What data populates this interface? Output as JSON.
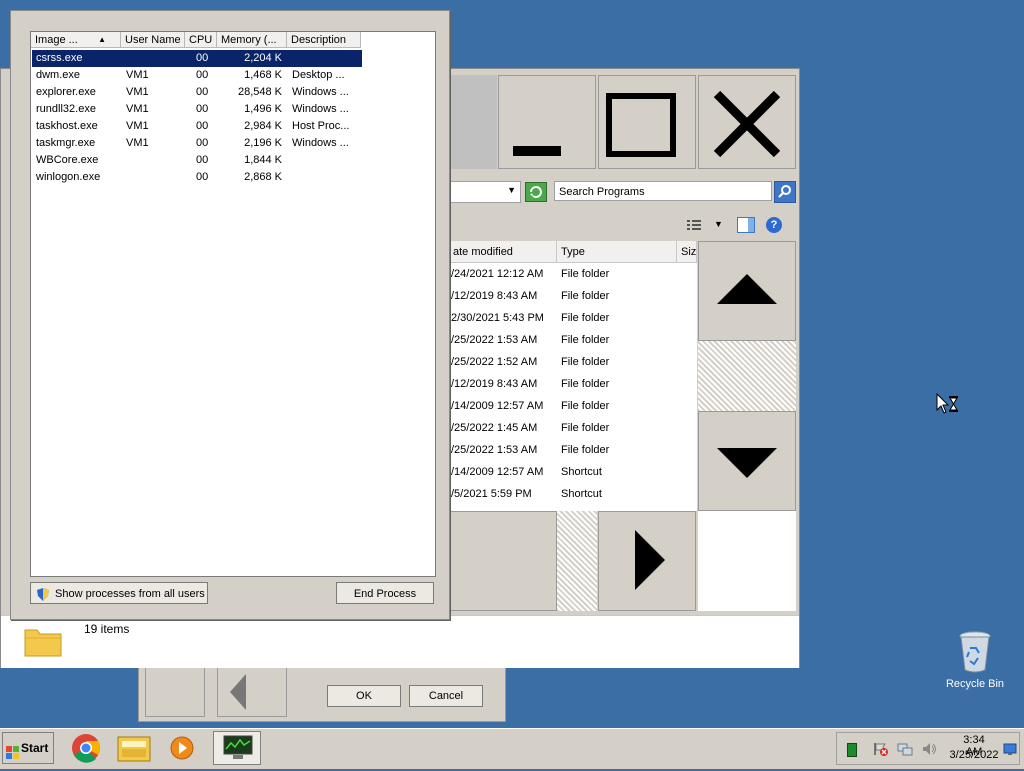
{
  "desktop": {
    "recycle_bin_label": "Recycle Bin"
  },
  "explorer": {
    "search_placeholder": "Search Programs",
    "columns": {
      "date_modified": "ate modified",
      "type": "Type",
      "size": "Size"
    },
    "files": [
      {
        "date": "/24/2021 12:12 AM",
        "type": "File folder"
      },
      {
        "date": "/12/2019 8:43 AM",
        "type": "File folder"
      },
      {
        "date": "2/30/2021 5:43 PM",
        "type": "File folder"
      },
      {
        "date": "/25/2022 1:53 AM",
        "type": "File folder"
      },
      {
        "date": "/25/2022 1:52 AM",
        "type": "File folder"
      },
      {
        "date": "/12/2019 8:43 AM",
        "type": "File folder"
      },
      {
        "date": "/14/2009 12:57 AM",
        "type": "File folder"
      },
      {
        "date": "/25/2022 1:45 AM",
        "type": "File folder"
      },
      {
        "date": "/25/2022 1:53 AM",
        "type": "File folder"
      },
      {
        "date": "/14/2009 12:57 AM",
        "type": "Shortcut"
      },
      {
        "date": "/5/2021 5:59 PM",
        "type": "Shortcut"
      }
    ],
    "status": "19 items"
  },
  "back_dialog": {
    "ok_label": "OK",
    "cancel_label": "Cancel"
  },
  "taskmgr": {
    "columns": {
      "image": "Image ...",
      "user": "User Name",
      "cpu": "CPU",
      "memory": "Memory (...",
      "description": "Description"
    },
    "processes": [
      {
        "image": "csrss.exe",
        "user": "",
        "cpu": "00",
        "memory": "2,204 K",
        "description": ""
      },
      {
        "image": "dwm.exe",
        "user": "VM1",
        "cpu": "00",
        "memory": "1,468 K",
        "description": "Desktop ..."
      },
      {
        "image": "explorer.exe",
        "user": "VM1",
        "cpu": "00",
        "memory": "28,548 K",
        "description": "Windows ..."
      },
      {
        "image": "rundll32.exe",
        "user": "VM1",
        "cpu": "00",
        "memory": "1,496 K",
        "description": "Windows ..."
      },
      {
        "image": "taskhost.exe",
        "user": "VM1",
        "cpu": "00",
        "memory": "2,984 K",
        "description": "Host Proc..."
      },
      {
        "image": "taskmgr.exe",
        "user": "VM1",
        "cpu": "00",
        "memory": "2,196 K",
        "description": "Windows ..."
      },
      {
        "image": "WBCore.exe",
        "user": "",
        "cpu": "00",
        "memory": "1,844 K",
        "description": ""
      },
      {
        "image": "winlogon.exe",
        "user": "",
        "cpu": "00",
        "memory": "2,868 K",
        "description": ""
      }
    ],
    "show_all_label": "Show processes from all users",
    "end_process_label": "End Process"
  },
  "taskbar": {
    "start_label": "Start",
    "clock_time": "3:34 AM",
    "clock_date": "3/25/2022"
  }
}
